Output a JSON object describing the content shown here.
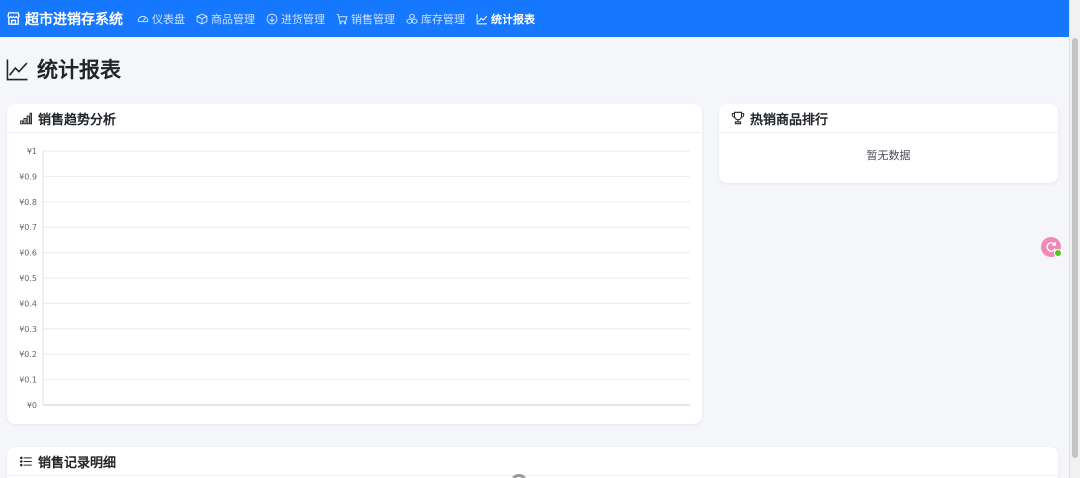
{
  "navbar": {
    "brand": "超市进销存系统",
    "items": [
      {
        "label": "仪表盘",
        "icon": "speedometer-icon",
        "active": false
      },
      {
        "label": "商品管理",
        "icon": "box-icon",
        "active": false
      },
      {
        "label": "进货管理",
        "icon": "arrow-down-circle-icon",
        "active": false
      },
      {
        "label": "销售管理",
        "icon": "cart-icon",
        "active": false
      },
      {
        "label": "库存管理",
        "icon": "boxes-icon",
        "active": false
      },
      {
        "label": "统计报表",
        "icon": "graph-up-icon",
        "active": true
      }
    ]
  },
  "page": {
    "title": "统计报表"
  },
  "sales_trend": {
    "title": "销售趋势分析"
  },
  "hot_products": {
    "title": "热销商品排行",
    "empty_text": "暂无数据"
  },
  "sales_records": {
    "title": "销售记录明细"
  },
  "colors": {
    "primary": "#1677ff",
    "background": "#f4f6f9",
    "card": "#ffffff",
    "float_button": "#f08ab4"
  },
  "chart_data": {
    "type": "line",
    "title": "",
    "xlabel": "",
    "ylabel": "",
    "ylim": [
      0,
      1
    ],
    "yticks": [
      "¥0",
      "¥0.1",
      "¥0.2",
      "¥0.3",
      "¥0.4",
      "¥0.5",
      "¥0.6",
      "¥0.7",
      "¥0.8",
      "¥0.9",
      "¥1"
    ],
    "x": [],
    "series": [],
    "grid": true
  }
}
